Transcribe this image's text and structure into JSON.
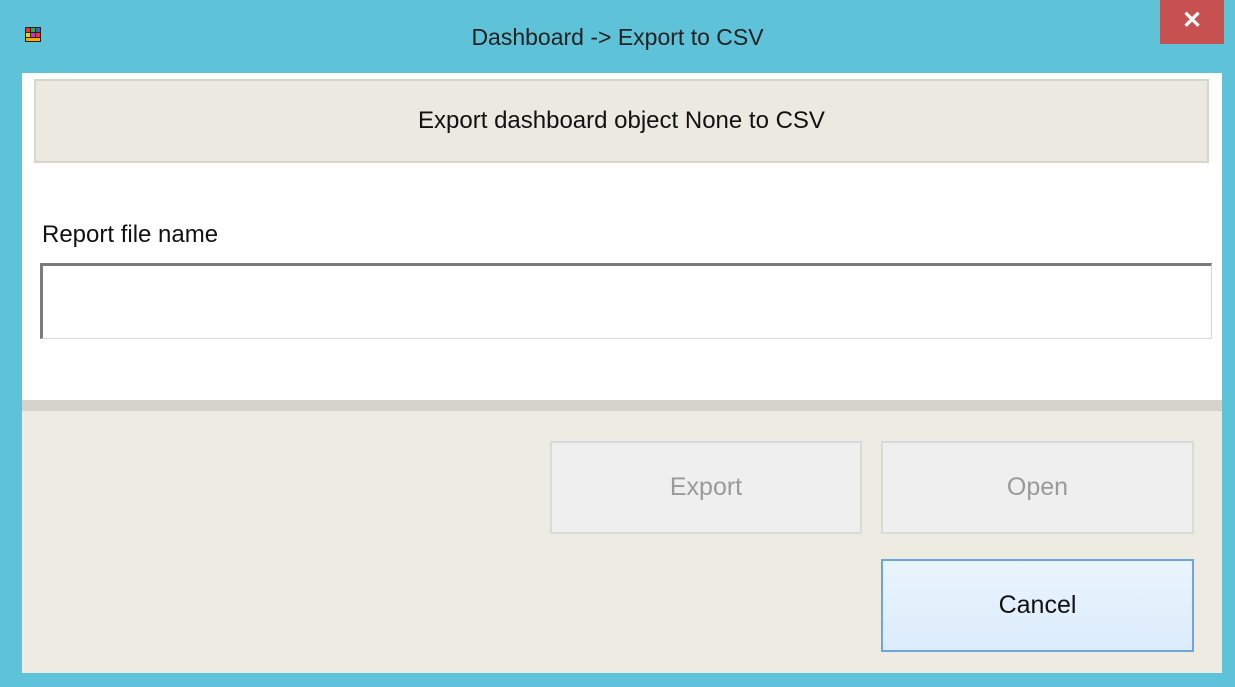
{
  "window": {
    "title": "Dashboard -> Export to CSV",
    "app_icon": "app-icon",
    "close_glyph": "✕"
  },
  "header": {
    "text": "Export dashboard object None to CSV"
  },
  "form": {
    "label": "Report file name",
    "value": "",
    "placeholder": ""
  },
  "buttons": {
    "export": "Export",
    "open": "Open",
    "cancel": "Cancel"
  },
  "colors": {
    "titlebar": "#5ec2d9",
    "close": "#c75050",
    "footer": "#eeebe2",
    "cancel_border": "#6aa7de"
  }
}
